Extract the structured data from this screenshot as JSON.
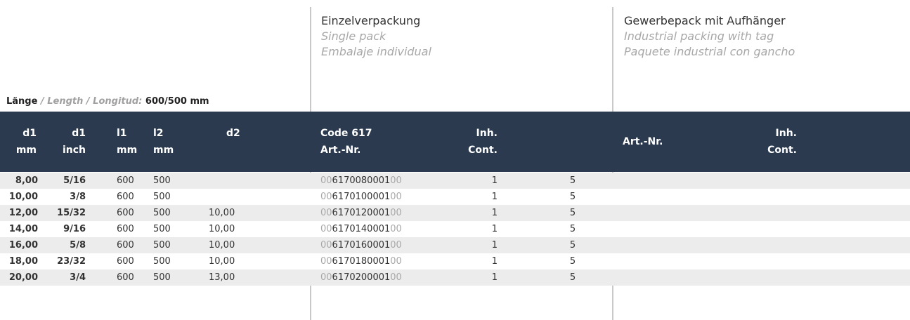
{
  "groups": {
    "single": {
      "de": "Einzelverpackung",
      "en": "Single pack",
      "es": "Embalaje individual"
    },
    "industrial": {
      "de": "Gewerbepack mit Aufhänger",
      "en": "Industrial packing with tag",
      "es": "Paquete industrial con gancho"
    }
  },
  "length_info": {
    "label_de": "Länge",
    "label_en_es": " / Length / Longitud:",
    "value": " 600/500 mm"
  },
  "header": {
    "d1_mm": [
      "d1",
      "mm"
    ],
    "d1_inch": [
      "d1",
      "inch"
    ],
    "l1": [
      "l1",
      "mm"
    ],
    "l2": [
      "l2",
      "mm"
    ],
    "d2": [
      "d2",
      ""
    ],
    "code": [
      "Code 617",
      "Art.-Nr."
    ],
    "inh1": [
      "Inh.",
      "Cont."
    ],
    "art2": "Art.-Nr.",
    "inh2": [
      "Inh.",
      "Cont."
    ],
    "box_icon": "box-icon"
  },
  "rows": [
    {
      "d1mm": "8,00",
      "d1inch": "5/16",
      "l1": "600",
      "l2": "500",
      "d2": "",
      "code_pre": "00",
      "code_main": "6170080001",
      "code_suf": "00",
      "inh": "1",
      "pack": "5"
    },
    {
      "d1mm": "10,00",
      "d1inch": "3/8",
      "l1": "600",
      "l2": "500",
      "d2": "",
      "code_pre": "00",
      "code_main": "6170100001",
      "code_suf": "00",
      "inh": "1",
      "pack": "5"
    },
    {
      "d1mm": "12,00",
      "d1inch": "15/32",
      "l1": "600",
      "l2": "500",
      "d2": "10,00",
      "code_pre": "00",
      "code_main": "6170120001",
      "code_suf": "00",
      "inh": "1",
      "pack": "5"
    },
    {
      "d1mm": "14,00",
      "d1inch": "9/16",
      "l1": "600",
      "l2": "500",
      "d2": "10,00",
      "code_pre": "00",
      "code_main": "6170140001",
      "code_suf": "00",
      "inh": "1",
      "pack": "5"
    },
    {
      "d1mm": "16,00",
      "d1inch": "5/8",
      "l1": "600",
      "l2": "500",
      "d2": "10,00",
      "code_pre": "00",
      "code_main": "6170160001",
      "code_suf": "00",
      "inh": "1",
      "pack": "5"
    },
    {
      "d1mm": "18,00",
      "d1inch": "23/32",
      "l1": "600",
      "l2": "500",
      "d2": "10,00",
      "code_pre": "00",
      "code_main": "6170180001",
      "code_suf": "00",
      "inh": "1",
      "pack": "5"
    },
    {
      "d1mm": "20,00",
      "d1inch": "3/4",
      "l1": "600",
      "l2": "500",
      "d2": "13,00",
      "code_pre": "00",
      "code_main": "6170200001",
      "code_suf": "00",
      "inh": "1",
      "pack": "5"
    }
  ],
  "colors": {
    "header_bg": "#2b3a4e",
    "row_alt": "#ececec",
    "divider": "#c8c8c8"
  }
}
